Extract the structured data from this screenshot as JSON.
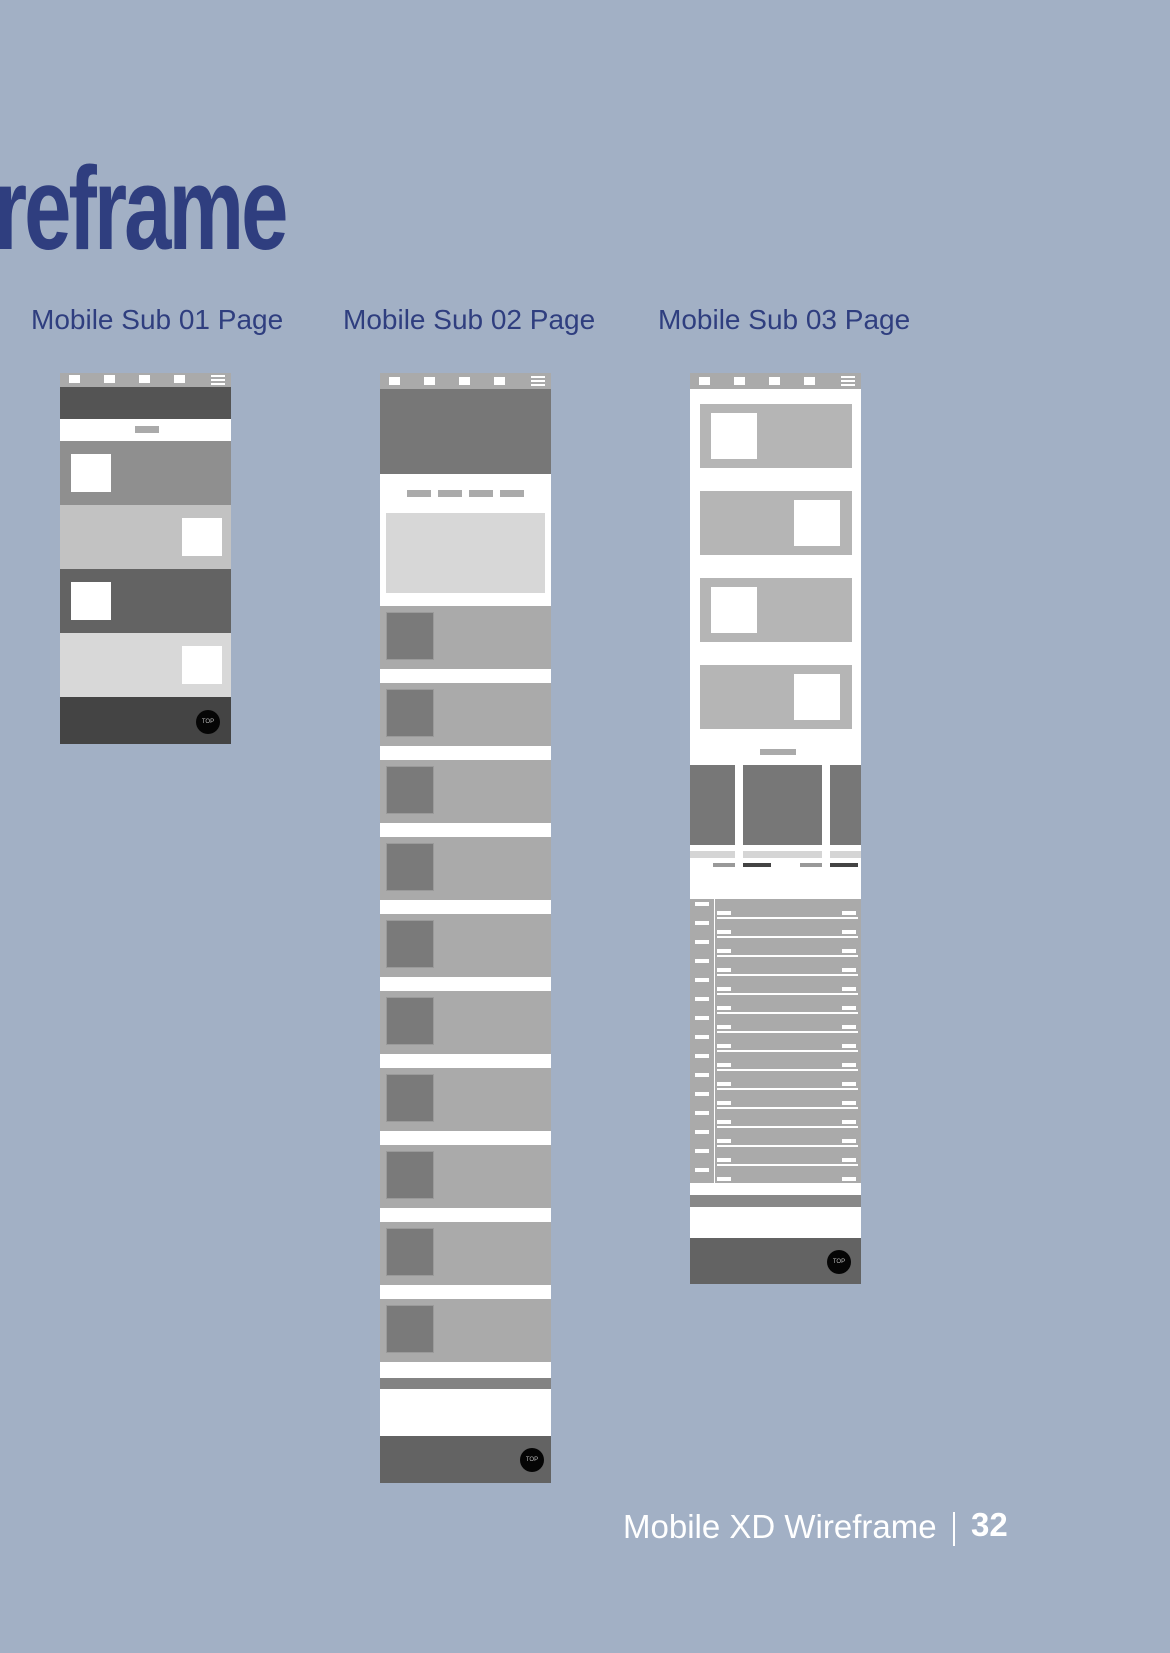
{
  "heading": {
    "title": "reframe"
  },
  "columns": [
    {
      "label": "Mobile Sub 01 Page"
    },
    {
      "label": "Mobile Sub 02 Page"
    },
    {
      "label": "Mobile Sub 03 Page"
    }
  ],
  "wireframe": {
    "top_button": "TOP"
  },
  "footer": {
    "label": "Mobile XD Wireframe",
    "page_number": "32"
  },
  "colors": {
    "background": "#a2b0c5",
    "heading": "#2f3e7f",
    "footer_text": "#ffffff"
  }
}
